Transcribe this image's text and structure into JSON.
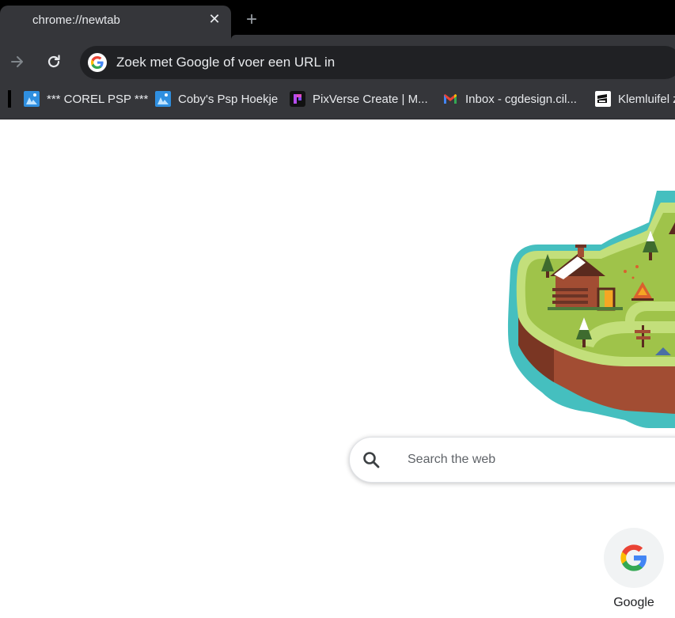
{
  "tab": {
    "title": "chrome://newtab",
    "close_glyph": "✕"
  },
  "new_tab_glyph": "+",
  "toolbar": {
    "forward_icon": "arrow-right-icon",
    "reload_icon": "reload-icon",
    "omnibox_placeholder": "Zoek met Google of voer een URL in"
  },
  "bookmarks": [
    {
      "label": "*** COREL PSP ***",
      "icon": "corel-favicon"
    },
    {
      "label": "Coby's Psp Hoekje",
      "icon": "corel-favicon"
    },
    {
      "label": "PixVerse Create | M...",
      "icon": "pixverse-favicon"
    },
    {
      "label": "Inbox - cgdesign.cil...",
      "icon": "gmail-favicon"
    },
    {
      "label": "Klemluifel z",
      "icon": "klemluifel-favicon"
    }
  ],
  "search": {
    "placeholder": "Search the web"
  },
  "shortcuts": [
    {
      "label": "Google",
      "icon": "google-icon"
    }
  ],
  "colors": {
    "chrome_dark": "#35363a",
    "omnibox_bg": "#202124",
    "page_bg": "#ffffff",
    "island_teal": "#45bfbf",
    "island_grass": "#9fc34a",
    "island_soil": "#a24d33"
  }
}
